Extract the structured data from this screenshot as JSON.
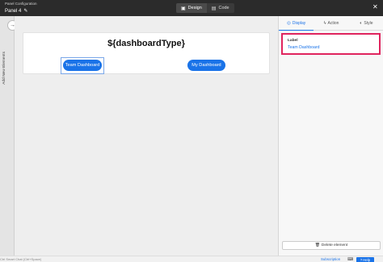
{
  "header": {
    "subtitle": "Panel Configuration",
    "panel_name": "Panel 4",
    "edit_icon": "pencil-icon",
    "mode_tabs": [
      {
        "label": "Design",
        "icon": "design-icon",
        "active": true
      },
      {
        "label": "Code",
        "icon": "code-icon",
        "active": false
      }
    ],
    "close_icon": "close-icon"
  },
  "left_strip": {
    "toggle_icon": "arrow-right-icon",
    "label": "Add New Elements"
  },
  "canvas": {
    "title": "${dashboardType}",
    "buttons": [
      {
        "label": "Team Dashboard",
        "selected": true
      },
      {
        "label": "My Dashboard",
        "selected": false
      }
    ]
  },
  "properties": {
    "tabs": [
      {
        "label": "Display",
        "icon": "display-icon",
        "active": true
      },
      {
        "label": "Action",
        "icon": "bolt-icon",
        "active": false
      },
      {
        "label": "Style",
        "icon": "palette-icon",
        "active": false
      }
    ],
    "field_label": "Label",
    "field_value": "Team Dashboard",
    "delete_label": "Delete element",
    "delete_icon": "trash-icon"
  },
  "status_bar": {
    "hint": "Ctrl Smart Chat (Ctrl+Space)",
    "subscription": "Subscription",
    "help_label": "Help",
    "accent_color": "#1a73e8"
  }
}
